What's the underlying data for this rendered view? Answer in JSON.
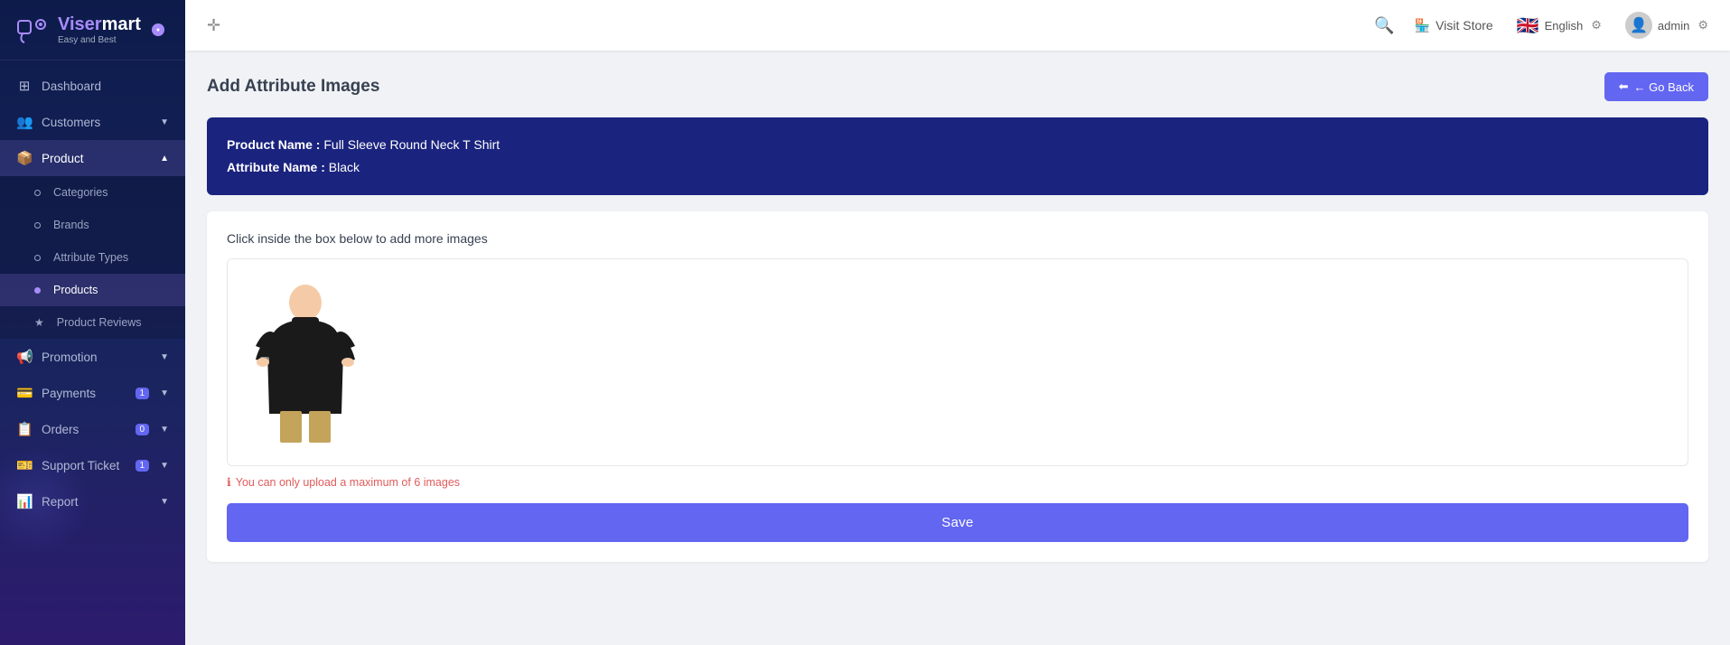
{
  "app": {
    "name_start": "Viser",
    "name_end": "mart",
    "tagline": "Easy and Best"
  },
  "topbar": {
    "visit_store_label": "Visit Store",
    "language_label": "English",
    "user_label": "admin",
    "flag_emoji": "🇬🇧"
  },
  "sidebar": {
    "items": [
      {
        "id": "dashboard",
        "label": "Dashboard",
        "icon": "⊞",
        "type": "link"
      },
      {
        "id": "customers",
        "label": "Customers",
        "icon": "👥",
        "type": "dropdown",
        "expanded": false
      },
      {
        "id": "product",
        "label": "Product",
        "icon": "📦",
        "type": "dropdown",
        "expanded": true
      },
      {
        "id": "attribute-types",
        "label": "Attribute Types",
        "icon": "gear",
        "sub": true
      },
      {
        "id": "products",
        "label": "Products",
        "icon": "box",
        "sub": true,
        "active": true
      },
      {
        "id": "product-reviews",
        "label": "Product Reviews",
        "icon": "star",
        "sub": true
      },
      {
        "id": "promotion",
        "label": "Promotion",
        "icon": "📢",
        "type": "dropdown"
      },
      {
        "id": "payments",
        "label": "Payments",
        "icon": "💳",
        "type": "dropdown",
        "badge": "1"
      },
      {
        "id": "orders",
        "label": "Orders",
        "icon": "📋",
        "type": "dropdown",
        "badge": "0"
      },
      {
        "id": "support-ticket",
        "label": "Support Ticket",
        "icon": "🎫",
        "type": "dropdown",
        "badge": "1"
      },
      {
        "id": "report",
        "label": "Report",
        "icon": "📊",
        "type": "dropdown"
      }
    ],
    "sub_items": {
      "product": [
        {
          "id": "categories",
          "label": "Categories",
          "dot": true
        },
        {
          "id": "brands",
          "label": "Brands",
          "dot": true
        },
        {
          "id": "attribute-types",
          "label": "Attribute Types",
          "dot": true
        },
        {
          "id": "products",
          "label": "Products",
          "dot": false,
          "active": true
        },
        {
          "id": "product-reviews",
          "label": "Product Reviews",
          "star": true
        }
      ]
    }
  },
  "page": {
    "title": "Add Attribute Images",
    "go_back_label": "← Go Back",
    "product_name_label": "Product Name",
    "product_name_value": "Full Sleeve Round Neck T Shirt",
    "attribute_name_label": "Attribute Name",
    "attribute_name_value": "Black",
    "upload_instruction": "Click inside the box below to add more images",
    "upload_hint": "You can only upload a maximum of 6 images",
    "save_label": "Save"
  }
}
